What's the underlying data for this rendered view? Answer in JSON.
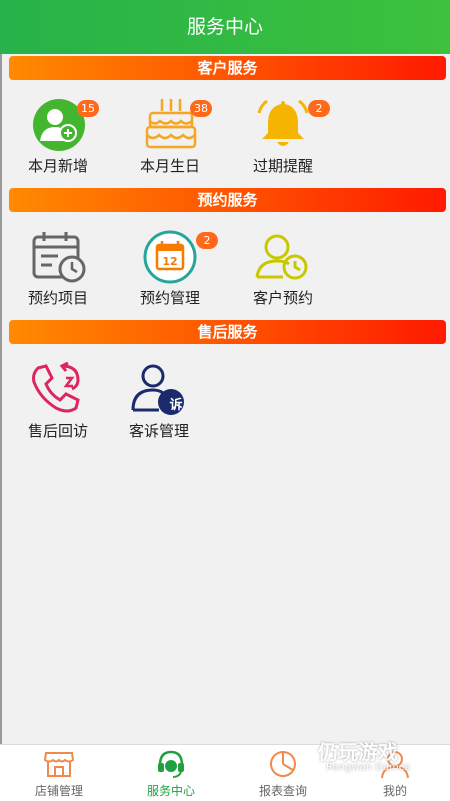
{
  "header": {
    "title": "服务中心"
  },
  "sections": {
    "customer": {
      "title": "客户服务",
      "items": [
        {
          "label": "本月新增",
          "badge": "15",
          "icon": "add-user-icon"
        },
        {
          "label": "本月生日",
          "badge": "38",
          "icon": "birthday-cake-icon"
        },
        {
          "label": "过期提醒",
          "badge": "2",
          "icon": "bell-icon"
        }
      ]
    },
    "appointment": {
      "title": "预约服务",
      "items": [
        {
          "label": "预约项目",
          "icon": "calendar-clock-icon"
        },
        {
          "label": "预约管理",
          "badge": "2",
          "calendar_day": "12",
          "icon": "calendar-day-icon"
        },
        {
          "label": "客户预约",
          "icon": "user-clock-icon"
        }
      ]
    },
    "aftersales": {
      "title": "售后服务",
      "items": [
        {
          "label": "售后回访",
          "icon": "callback-phone-icon"
        },
        {
          "label": "客诉管理",
          "badge_char": "诉",
          "icon": "complaint-user-icon"
        }
      ]
    }
  },
  "tabbar": {
    "items": [
      {
        "label": "店铺管理",
        "icon": "store-icon"
      },
      {
        "label": "服务中心",
        "icon": "headset-icon",
        "active": true
      },
      {
        "label": "报表查询",
        "icon": "report-icon"
      },
      {
        "label": "我的",
        "icon": "profile-icon"
      }
    ]
  },
  "watermark": {
    "text": "仍玩游戏",
    "sub": "Rengwan Games"
  },
  "colors": {
    "header": "#2bb444",
    "accent_orange": "#ff6a1a",
    "section_bar_start": "#ff8a00",
    "section_bar_end": "#ff1a00",
    "active_tab": "#20a040"
  }
}
